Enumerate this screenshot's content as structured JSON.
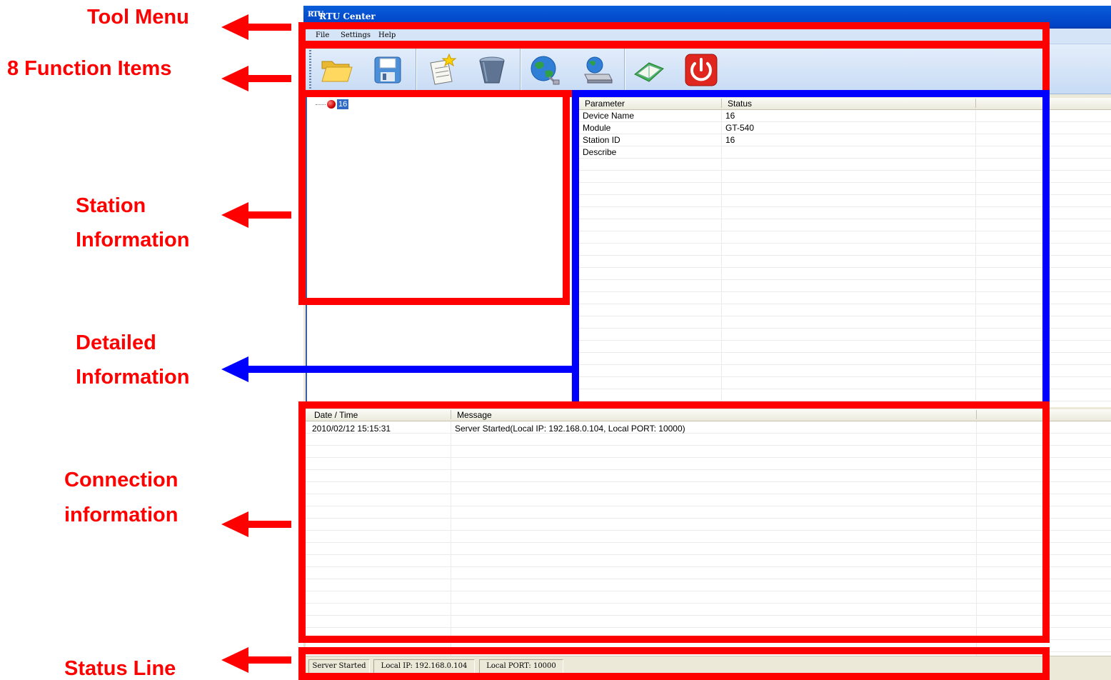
{
  "annotations": {
    "tool_menu": "Tool Menu",
    "function_items": "8 Function Items",
    "station_line1": "Station",
    "station_line2": "Information",
    "detailed_line1": "Detailed",
    "detailed_line2": "Information",
    "connection_line1": "Connection",
    "connection_line2": "information",
    "status_line": "Status Line",
    "red_color": "#ff0000",
    "blue_color": "#0000ff"
  },
  "window": {
    "title": "RTU Center",
    "icon_text": "RTU"
  },
  "menu": {
    "file": "File",
    "settings": "Settings",
    "help": "Help"
  },
  "toolbar": {
    "buttons": [
      "open-folder-icon",
      "save-disk-icon",
      "new-document-icon",
      "delete-bin-icon",
      "globe-connect-icon",
      "network-device-icon",
      "book-icon",
      "power-icon"
    ]
  },
  "tree": {
    "node_label": "16",
    "node_status_color": "#cc0000"
  },
  "detail": {
    "columns": [
      "Parameter",
      "Status"
    ],
    "rows": [
      {
        "param": "Device Name",
        "value": "16"
      },
      {
        "param": "Module",
        "value": "GT-540"
      },
      {
        "param": "Station ID",
        "value": "16"
      },
      {
        "param": "Describe",
        "value": ""
      }
    ]
  },
  "log": {
    "columns": [
      "Date / Time",
      "Message"
    ],
    "rows": [
      {
        "datetime": "2010/02/12   15:15:31",
        "message": "Server Started(Local IP: 192.168.0.104, Local PORT: 10000)"
      }
    ]
  },
  "statusbar": {
    "state": "Server Started",
    "local_ip": "Local IP: 192.168.0.104",
    "local_port": "Local PORT: 10000"
  }
}
